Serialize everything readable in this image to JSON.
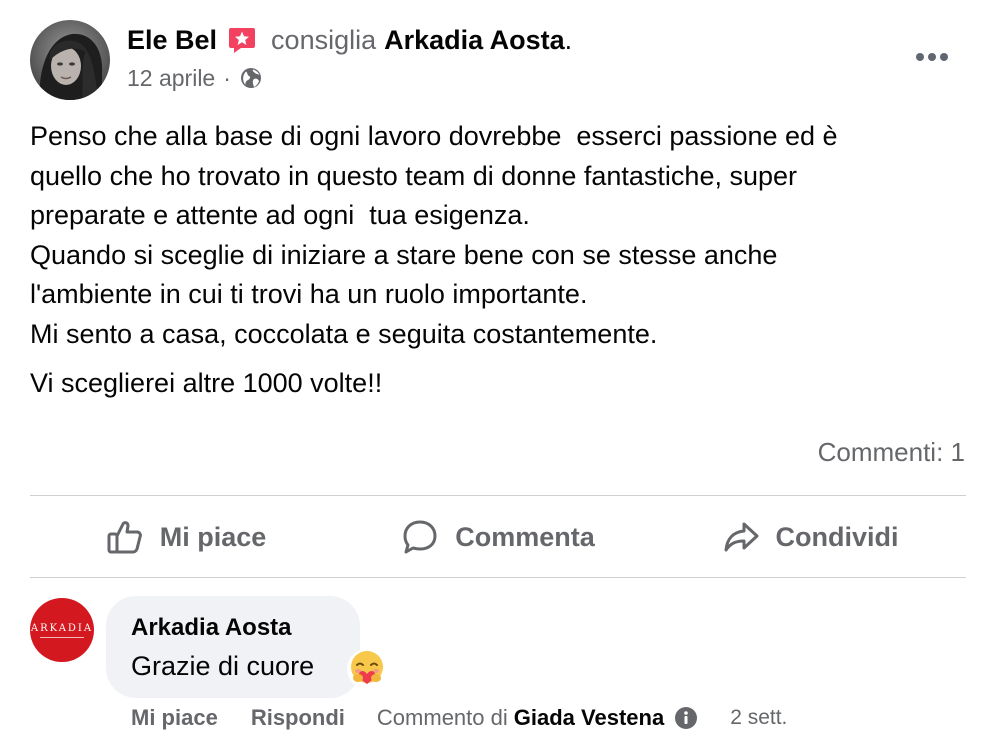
{
  "post": {
    "author": "Ele Bel",
    "recommend_word": "consiglia",
    "page_name": "Arkadia Aosta",
    "period": ".",
    "date": "12 aprile",
    "separator": "·",
    "body_lines": [
      "Penso che alla base di ogni lavoro dovrebbe  esserci passione ed è",
      "quello che ho trovato in questo team di donne fantastiche, super",
      "preparate e attente ad ogni  tua esigenza.",
      "Quando si sceglie di iniziare a stare bene con se stesse anche",
      "l'ambiente in cui ti trovi ha un ruolo importante.",
      "Mi sento a casa, coccolata e seguita costantemente.",
      "Vi sceglierei altre 1000 volte!!"
    ],
    "comments_count": "Commenti: 1"
  },
  "actions": {
    "like": "Mi piace",
    "comment": "Commenta",
    "share": "Condividi"
  },
  "comment": {
    "author": "Arkadia Aosta",
    "text": "Grazie di cuore",
    "logo_text": "ARKADIA",
    "like": "Mi piace",
    "reply": "Rispondi",
    "by_label": "Commento di",
    "by_name": "Giada Vestena",
    "time": "2 sett."
  },
  "colors": {
    "recommend_badge": "#f3425f",
    "logo_background": "#d3181f",
    "secondary_text": "#65676b"
  },
  "icons": {
    "recommend": "star-badge-icon",
    "privacy": "globe-icon",
    "more": "more-dots-icon",
    "like": "thumbs-up-icon",
    "comment": "speech-bubble-icon",
    "share": "share-arrow-icon",
    "reaction": "hug-emoji-icon",
    "info": "info-icon"
  }
}
